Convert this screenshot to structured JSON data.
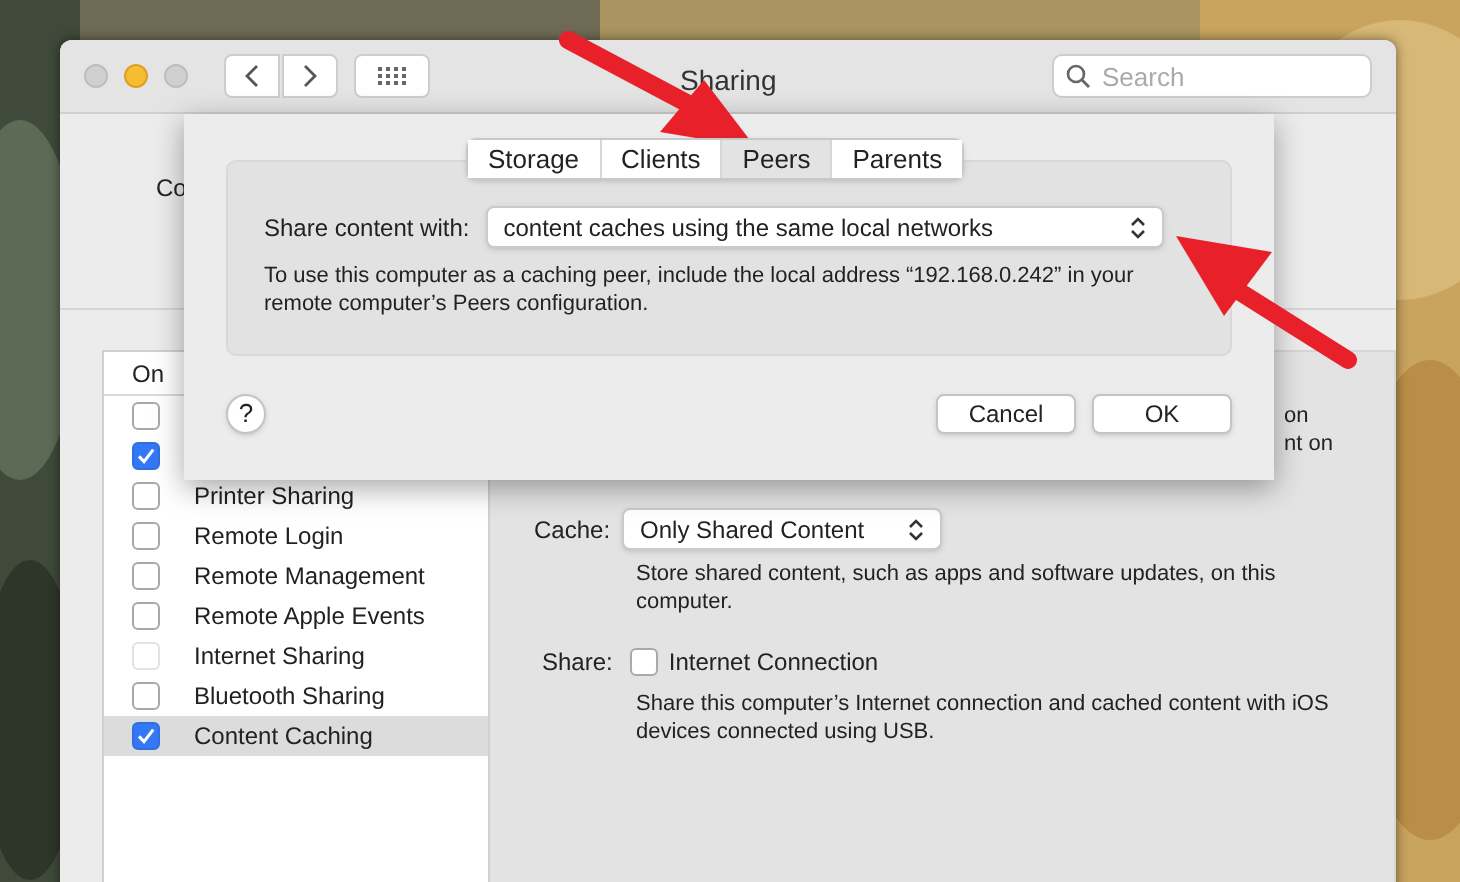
{
  "window": {
    "title": "Sharing",
    "search": {
      "placeholder": "Search"
    }
  },
  "top_area": {
    "label_fragment": "Co"
  },
  "services": {
    "header": "On",
    "items": [
      {
        "checked": false,
        "disabled": false,
        "selected": false
      },
      {
        "checked": true,
        "disabled": false,
        "selected": false
      },
      {
        "label": "Printer Sharing",
        "checked": false,
        "disabled": false,
        "selected": false
      },
      {
        "label": "Remote Login",
        "checked": false,
        "disabled": false,
        "selected": false
      },
      {
        "label": "Remote Management",
        "checked": false,
        "disabled": false,
        "selected": false
      },
      {
        "label": "Remote Apple Events",
        "checked": false,
        "disabled": false,
        "selected": false
      },
      {
        "label": "Internet Sharing",
        "checked": false,
        "disabled": true,
        "selected": false
      },
      {
        "label": "Bluetooth Sharing",
        "checked": false,
        "disabled": false,
        "selected": false
      },
      {
        "label": "Content Caching",
        "checked": true,
        "disabled": false,
        "selected": true
      }
    ]
  },
  "detail": {
    "fragments": [
      "on",
      "nt on"
    ],
    "cache": {
      "label": "Cache:",
      "value": "Only Shared Content",
      "description": "Store shared content, such as apps and software updates, on this computer."
    },
    "share": {
      "label": "Share:",
      "option": "Internet Connection",
      "checked": false,
      "description": "Share this computer’s Internet connection and cached content with iOS devices connected using USB."
    }
  },
  "sheet": {
    "tabs": [
      {
        "label": "Storage",
        "selected": false
      },
      {
        "label": "Clients",
        "selected": false
      },
      {
        "label": "Peers",
        "selected": true
      },
      {
        "label": "Parents",
        "selected": false
      }
    ],
    "share_with": {
      "label": "Share content with:",
      "value": "content caches using the same local networks"
    },
    "note": "To use this computer as a caching peer, include the local address “192.168.0.242” in your remote computer’s Peers configuration.",
    "help": "?",
    "buttons": [
      "Cancel",
      "OK"
    ]
  }
}
